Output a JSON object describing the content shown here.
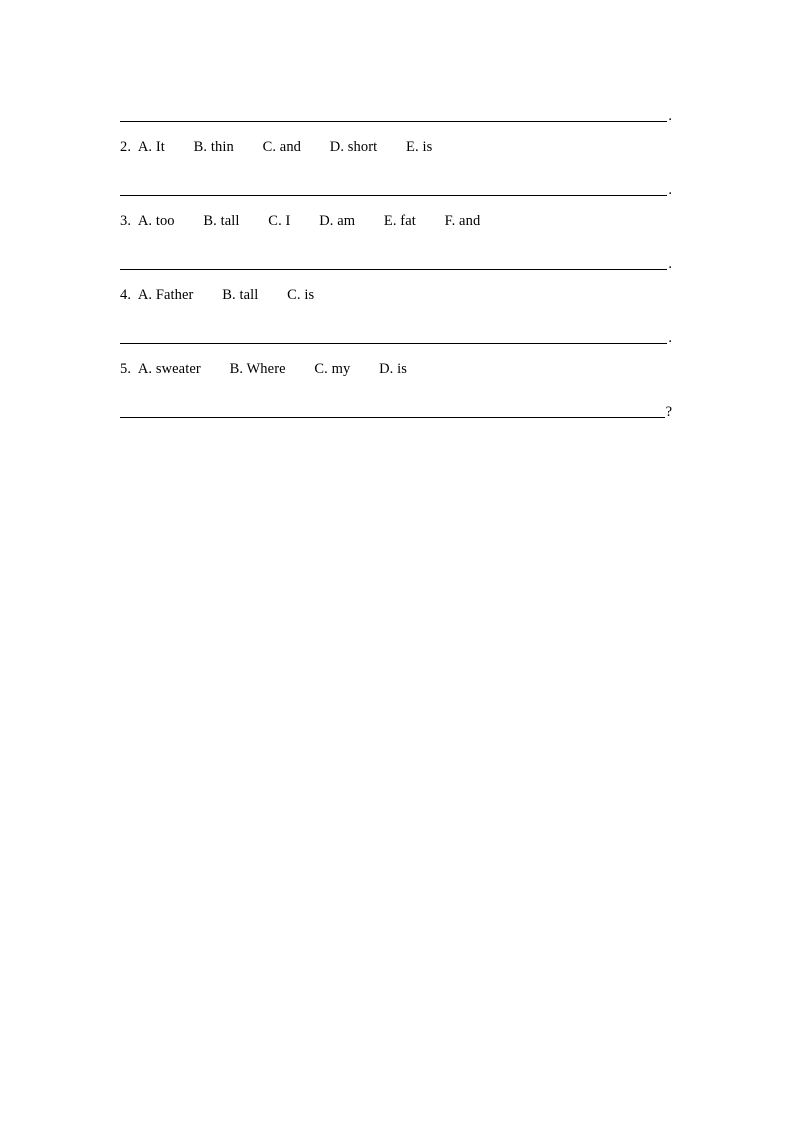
{
  "document": {
    "page_background": "#ffffff",
    "text_color": "#000000",
    "rule_color": "#000000",
    "exercise_items": [
      {
        "blank_punct": ".",
        "number": "2.",
        "options": [
          "A. It",
          "B. thin",
          "C. and",
          "D. short",
          "E. is"
        ]
      },
      {
        "blank_punct": ".",
        "number": "3.",
        "options": [
          "A. too",
          "B. tall",
          "C. I",
          "D. am",
          "E. fat",
          "F. and"
        ]
      },
      {
        "blank_punct": ".",
        "number": "4.",
        "options": [
          "A. Father",
          "B. tall",
          "C. is"
        ]
      },
      {
        "blank_punct": ".",
        "number": "5.",
        "options": [
          "A. sweater",
          "B. Where",
          "C. my",
          "D. is"
        ]
      },
      {
        "blank_punct": "?",
        "number": "",
        "options": []
      }
    ]
  }
}
